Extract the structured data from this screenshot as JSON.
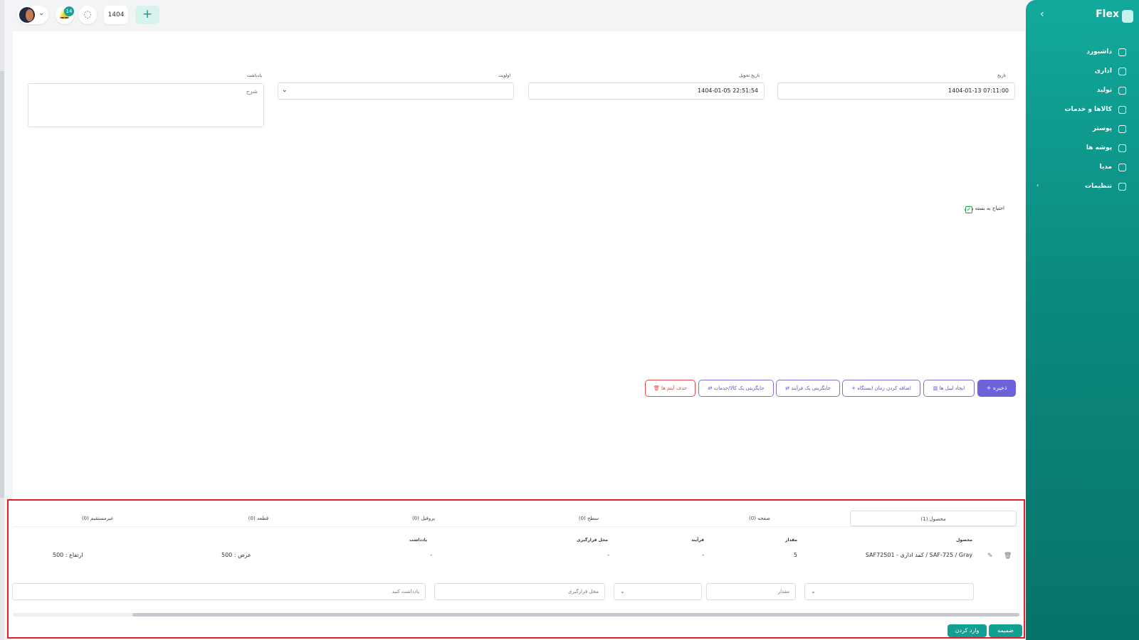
{
  "topbar": {
    "notification_count": "14",
    "year": "1404",
    "add_symbol": "+"
  },
  "sidebar": {
    "brand": "Flex",
    "items": [
      {
        "label": "داشبورد",
        "icon": "home-icon"
      },
      {
        "label": "اداری",
        "icon": "briefcase-icon"
      },
      {
        "label": "تولید",
        "icon": "factory-icon"
      },
      {
        "label": "کالاها و خدمات",
        "icon": "box-icon"
      },
      {
        "label": "پوستر",
        "icon": "image-icon"
      },
      {
        "label": "پوشه ها",
        "icon": "folder-icon"
      },
      {
        "label": "مدیا",
        "icon": "media-icon"
      },
      {
        "label": "تنظیمات",
        "icon": "gear-icon"
      }
    ]
  },
  "form": {
    "date_label": "تاریخ",
    "date_value": "1404-01-13 07:11:00",
    "delivery_label": "تاریخ تحویل",
    "delivery_value": "1404-01-05 22:51:54",
    "priority_label": "اولویت",
    "note_label": "یادداشت",
    "note_placeholder": "شرح",
    "packaging_label": "احتیاج به بسته بندی"
  },
  "actions": {
    "save": "ذخیره",
    "labels": "ایجاد لیبل ها",
    "station_time": "اضافه کردن زمان ایستگاه",
    "replace_process": "جایگزینی یک فرآیند",
    "replace_goods": "جایگزینی یک کالا/خدمات",
    "delete_items": "حذف آیتم ها"
  },
  "tabs": [
    {
      "label": "محصول (1)"
    },
    {
      "label": "صفحه (0)"
    },
    {
      "label": "سطح (0)"
    },
    {
      "label": "پروفیل (0)"
    },
    {
      "label": "قطعه (0)"
    },
    {
      "label": "غیرمستقیم (0)"
    }
  ],
  "table": {
    "headers": {
      "product": "محصول",
      "quantity": "مقدار",
      "process": "فرآیند",
      "placement": "محل قرارگیری",
      "note": "یادداشت"
    },
    "row": {
      "product": "SAF72501 - کمد اداری / SAF-725 / Gray",
      "quantity": "5",
      "process": "-",
      "placement": "-",
      "note": "-",
      "width": "عرض : 500",
      "height": "ارتفاع : 500"
    }
  },
  "new_row": {
    "quantity_placeholder": "مقدار",
    "placement_placeholder": "محل قرارگیری",
    "note_placeholder": "یادداشت کنید"
  },
  "footer": {
    "attach": "ضمیمه",
    "enter": "وارد کردن"
  }
}
